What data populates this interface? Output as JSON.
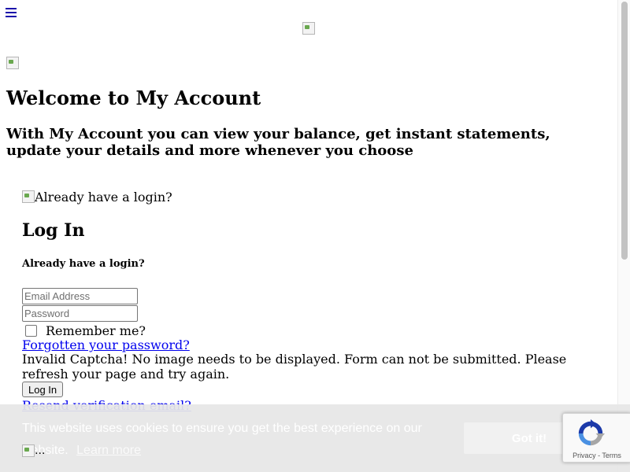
{
  "header": {
    "menu_icon": "hamburger-menu-icon"
  },
  "welcome": {
    "title": "Welcome to My Account",
    "subtitle": "With My Account you can view your balance, get instant statements, update your details and more whenever you choose"
  },
  "login": {
    "image_alt": "Already have a login?",
    "title": "Log In",
    "already": "Already have a login?",
    "email_placeholder": "Email Address",
    "password_placeholder": "Password",
    "remember_label": "Remember me?",
    "forgot_link": "Forgotten your password?",
    "captcha_error": "Invalid Captcha! No image needs to be displayed. Form can not be submitted. Please refresh your page and try again.",
    "login_button": "Log In",
    "resend_link": "Resend verification email?"
  },
  "cookie": {
    "message": "This website uses cookies to ensure you get the best experience on our website.",
    "learn_more": "Learn more",
    "got_it": "Got it!"
  },
  "bottom_image_alt": "...",
  "recaptcha": {
    "privacy": "Privacy",
    "separator": " - ",
    "terms": "Terms"
  },
  "colors": {
    "link": "#0000ee",
    "cookie_bar": "#e6e6e6",
    "recaptcha_blue": "#1c3aa9",
    "recaptcha_gray": "#a6a6a6"
  }
}
